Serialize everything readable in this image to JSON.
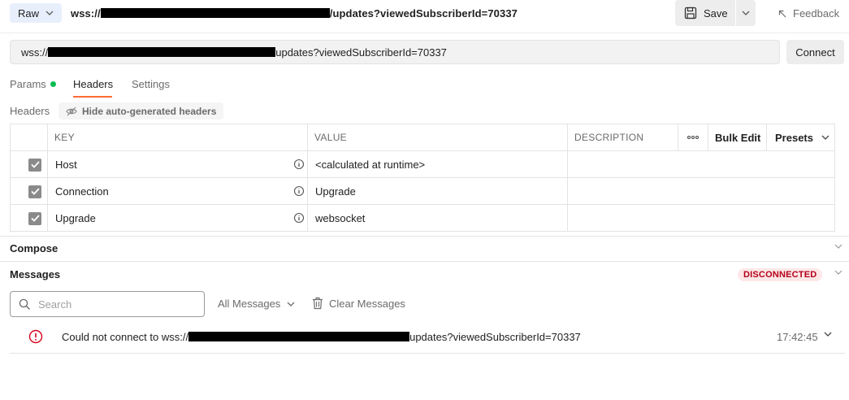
{
  "topbar": {
    "mode_label": "Raw",
    "title_prefix": "wss://",
    "title_suffix": "/updates?viewedSubscriberId=70337",
    "save_label": "Save",
    "feedback_label": "Feedback"
  },
  "url": {
    "prefix": "wss://",
    "suffix": "updates?viewedSubscriberId=70337",
    "connect_label": "Connect"
  },
  "tabs": [
    {
      "label": "Params",
      "has_dot": true
    },
    {
      "label": "Headers",
      "active": true
    },
    {
      "label": "Settings"
    }
  ],
  "headers_section": {
    "label": "Headers",
    "hide_auto_label": "Hide auto-generated headers"
  },
  "table": {
    "columns": [
      "KEY",
      "VALUE",
      "DESCRIPTION"
    ],
    "more_label": "ooo",
    "bulk_edit_label": "Bulk Edit",
    "presets_label": "Presets",
    "rows": [
      {
        "key": "Host",
        "value": "<calculated at runtime>",
        "checked": true
      },
      {
        "key": "Connection",
        "value": "Upgrade",
        "checked": true
      },
      {
        "key": "Upgrade",
        "value": "websocket",
        "checked": true
      }
    ]
  },
  "compose": {
    "title": "Compose"
  },
  "messages": {
    "title": "Messages",
    "status_badge": "DISCONNECTED",
    "search_placeholder": "Search",
    "filter_label": "All Messages",
    "clear_label": "Clear Messages",
    "items": [
      {
        "text_prefix": "Could not connect to wss://",
        "text_suffix": "updates?viewedSubscriberId=70337",
        "time": "17:42:45"
      }
    ]
  },
  "colors": {
    "accent_tab": "#ff6c37",
    "status_dot": "#0cbb52",
    "error": "#d9001b",
    "disconnected_bg": "#fde7e7"
  }
}
